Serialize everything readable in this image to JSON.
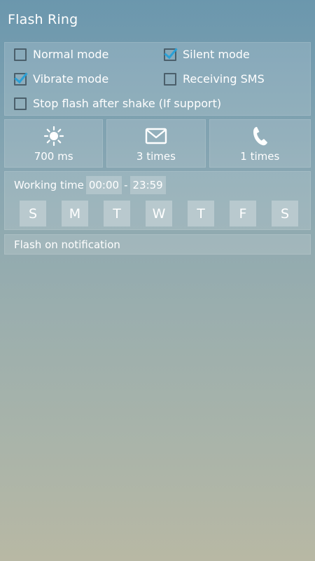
{
  "app": {
    "title": "Flash Ring"
  },
  "modes": {
    "normal": {
      "label": "Normal mode",
      "checked": false
    },
    "silent": {
      "label": "Silent mode",
      "checked": true
    },
    "vibrate": {
      "label": "Vibrate mode",
      "checked": true
    },
    "sms": {
      "label": "Receiving SMS",
      "checked": false
    },
    "shake": {
      "label": "Stop flash after shake (If support)",
      "checked": false
    }
  },
  "tiles": {
    "flash": {
      "icon": "sun-icon",
      "value": "700 ms"
    },
    "sms": {
      "icon": "envelope-icon",
      "value": "3 times"
    },
    "call": {
      "icon": "phone-icon",
      "value": "1 times"
    }
  },
  "working_time": {
    "label": "Working time",
    "start": "00:00",
    "separator": "-",
    "end": "23:59",
    "days": [
      "S",
      "M",
      "T",
      "W",
      "T",
      "F",
      "S"
    ]
  },
  "notification": {
    "label": "Flash on notification"
  },
  "colors": {
    "check_accent": "#2aa0d6",
    "checkbox_border": "#4b5f6b"
  }
}
